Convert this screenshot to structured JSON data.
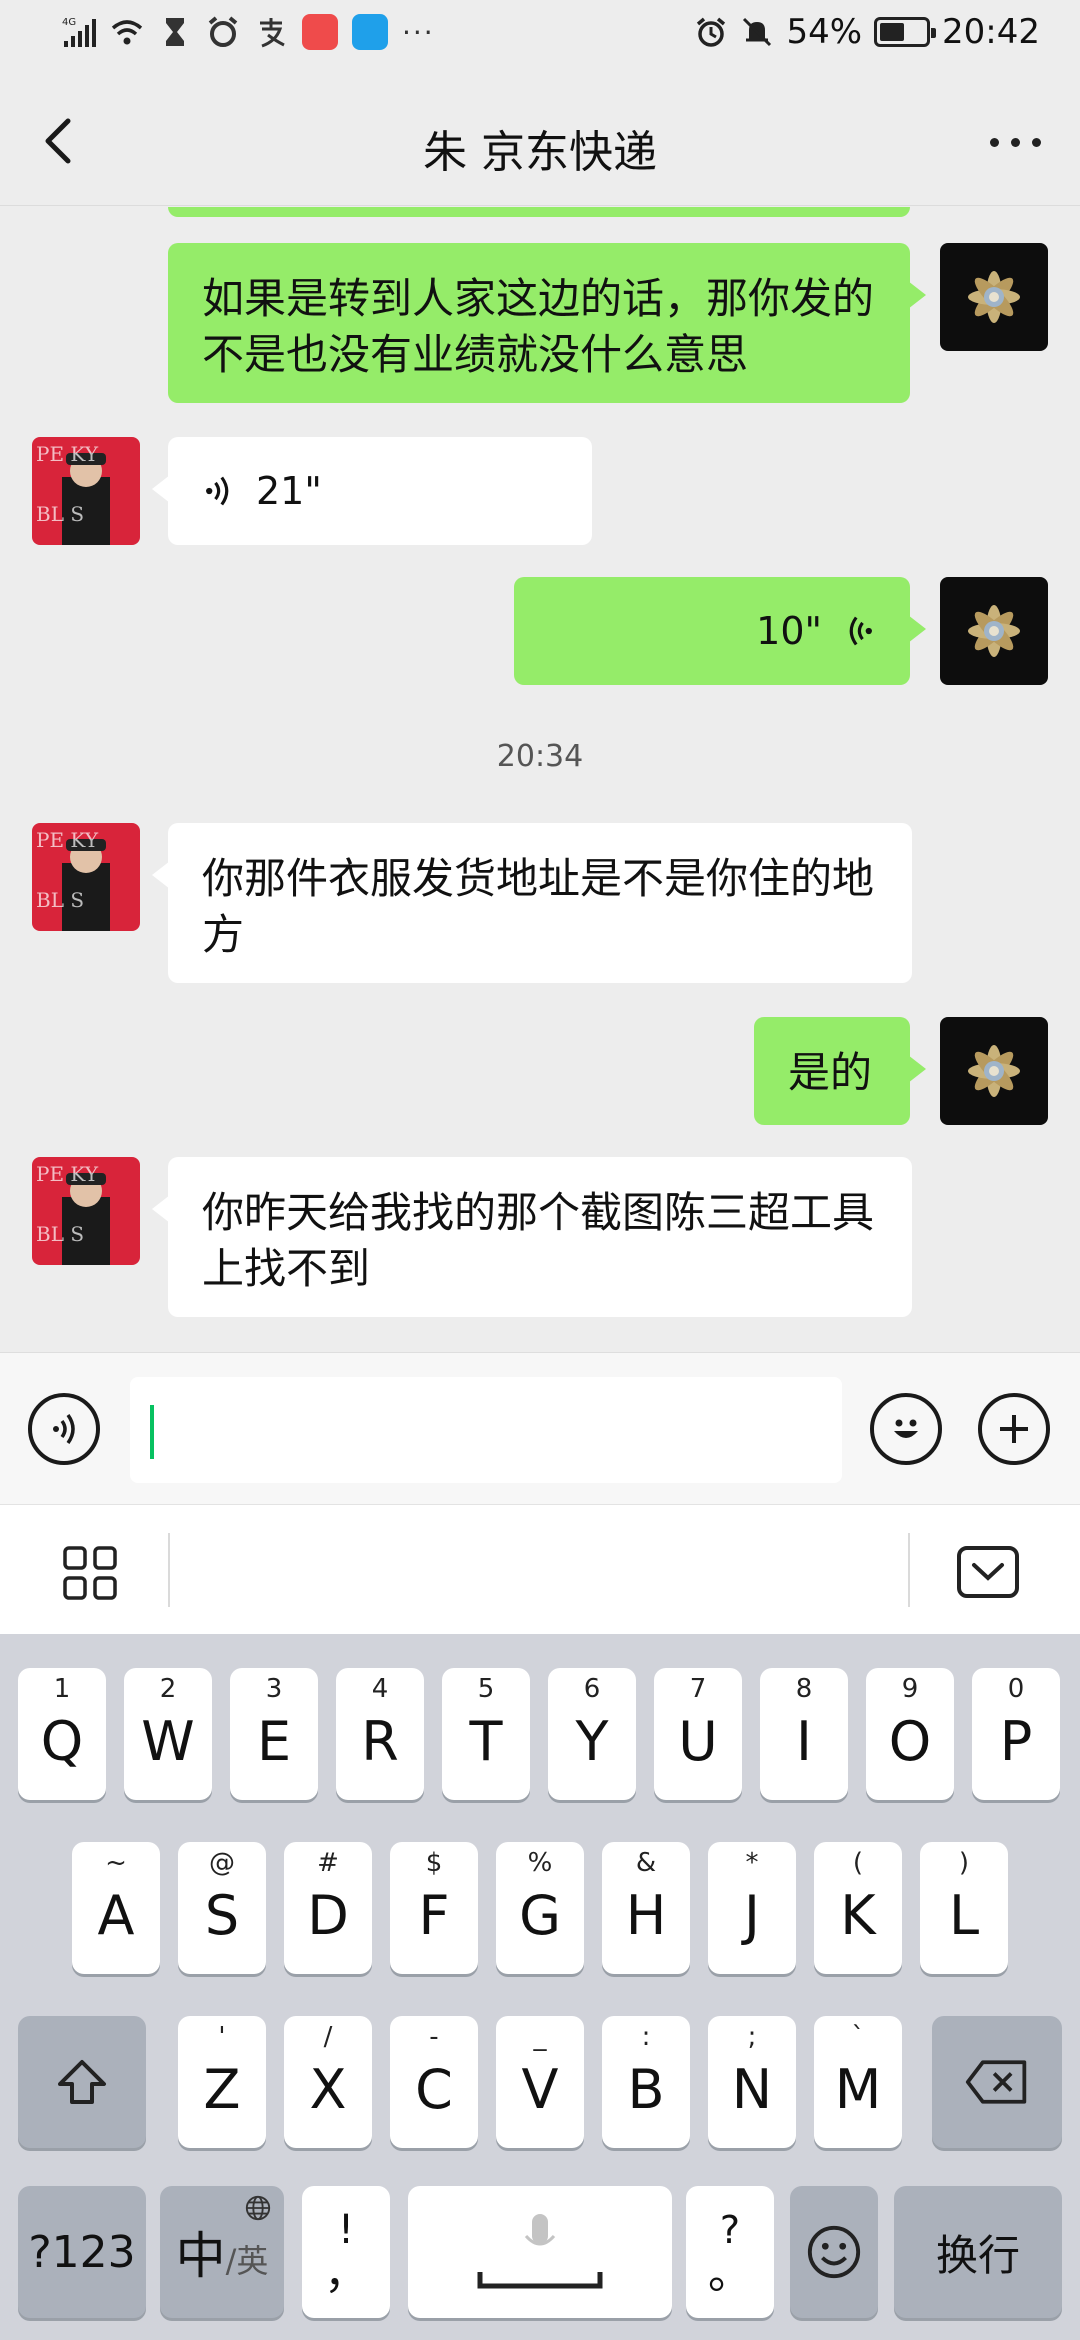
{
  "status_bar": {
    "network": "4G",
    "battery_percent": "54%",
    "battery_level": 0.54,
    "time": "20:42",
    "more_indicator": "···",
    "icons": [
      "signal-icon",
      "wifi-icon",
      "hourglass-icon",
      "alarm-clock-icon",
      "alipay-icon",
      "huawei-app-icon",
      "ele-me-icon",
      "alarm-icon",
      "mute-bell-icon",
      "battery-icon"
    ]
  },
  "header": {
    "title": "朱 京东快递",
    "back_icon": "back-chevron-icon",
    "more_icon": "more-dots-icon"
  },
  "messages": [
    {
      "direction": "out",
      "type": "text",
      "text": "如果是转到人家这边的话，那你发的不是也没有业绩就没什么意思"
    },
    {
      "direction": "in",
      "type": "voice",
      "duration": "21\""
    },
    {
      "direction": "out",
      "type": "voice",
      "duration": "10\""
    },
    {
      "type": "timestamp",
      "text": "20:34"
    },
    {
      "direction": "in",
      "type": "text",
      "text": "你那件衣服发货地址是不是你住的地方"
    },
    {
      "direction": "out",
      "type": "text",
      "text": "是的"
    },
    {
      "direction": "in",
      "type": "text",
      "text": "你昨天给我找的那个截图陈三超工具上找不到"
    }
  ],
  "input_bar": {
    "value": "",
    "voice_icon": "voice-input-icon",
    "emoji_icon": "emoji-icon",
    "plus_icon": "plus-icon"
  },
  "keyboard": {
    "toolbar": {
      "grid_icon": "grid-icon",
      "collapse_icon": "keyboard-collapse-icon"
    },
    "row1": [
      {
        "hint": "1",
        "label": "Q"
      },
      {
        "hint": "2",
        "label": "W"
      },
      {
        "hint": "3",
        "label": "E"
      },
      {
        "hint": "4",
        "label": "R"
      },
      {
        "hint": "5",
        "label": "T"
      },
      {
        "hint": "6",
        "label": "Y"
      },
      {
        "hint": "7",
        "label": "U"
      },
      {
        "hint": "8",
        "label": "I"
      },
      {
        "hint": "9",
        "label": "O"
      },
      {
        "hint": "0",
        "label": "P"
      }
    ],
    "row2": [
      {
        "hint": "~",
        "label": "A"
      },
      {
        "hint": "@",
        "label": "S"
      },
      {
        "hint": "#",
        "label": "D"
      },
      {
        "hint": "$",
        "label": "F"
      },
      {
        "hint": "%",
        "label": "G"
      },
      {
        "hint": "&",
        "label": "H"
      },
      {
        "hint": "*",
        "label": "J"
      },
      {
        "hint": "(",
        "label": "K"
      },
      {
        "hint": ")",
        "label": "L"
      }
    ],
    "row3": [
      {
        "hint": "'",
        "label": "Z"
      },
      {
        "hint": "/",
        "label": "X"
      },
      {
        "hint": "-",
        "label": "C"
      },
      {
        "hint": "_",
        "label": "V"
      },
      {
        "hint": ":",
        "label": "B"
      },
      {
        "hint": ";",
        "label": "N"
      },
      {
        "hint": "`",
        "label": "M"
      }
    ],
    "bottom": {
      "num_key": "?123",
      "lang_key_main": "中",
      "lang_key_sub": "/英",
      "punct_top": "!",
      "punct_bottom": "，",
      "punct2_top": "?",
      "punct2_bottom": "。",
      "enter_key": "换行"
    }
  }
}
